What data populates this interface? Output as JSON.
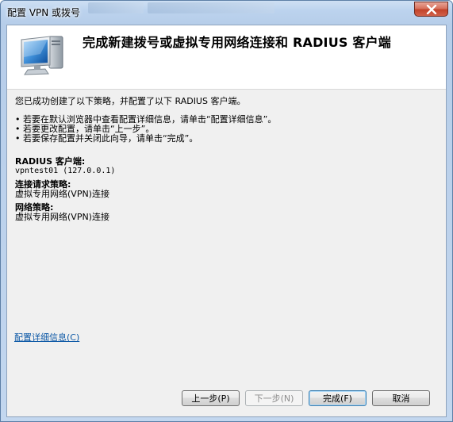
{
  "window": {
    "title": "配置 VPN 或拨号"
  },
  "header": {
    "title": "完成新建拨号或虚拟专用网络连接和 RADIUS 客户端"
  },
  "body": {
    "intro": "您已成功创建了以下策略，并配置了以下 RADIUS 客户端。",
    "bullets": [
      "• 若要在默认浏览器中查看配置详细信息，请单击“配置详细信息”。",
      "• 若要更改配置，请单击“上一步”。",
      "• 若要保存配置并关闭此向导，请单击“完成”。"
    ],
    "radius_label": "RADIUS 客户端:",
    "radius_value": "vpntest01 (127.0.0.1)",
    "request_policy_label": "连接请求策略:",
    "request_policy_value": "虚拟专用网络(VPN)连接",
    "network_policy_label": "网络策略:",
    "network_policy_value": "虚拟专用网络(VPN)连接"
  },
  "link": {
    "details": "配置详细信息(C)"
  },
  "buttons": {
    "back": "上一步(P)",
    "next": "下一步(N)",
    "finish": "完成(F)",
    "cancel": "取消"
  },
  "icons": {
    "header": "vpn-computer-icon",
    "close": "close-icon"
  }
}
